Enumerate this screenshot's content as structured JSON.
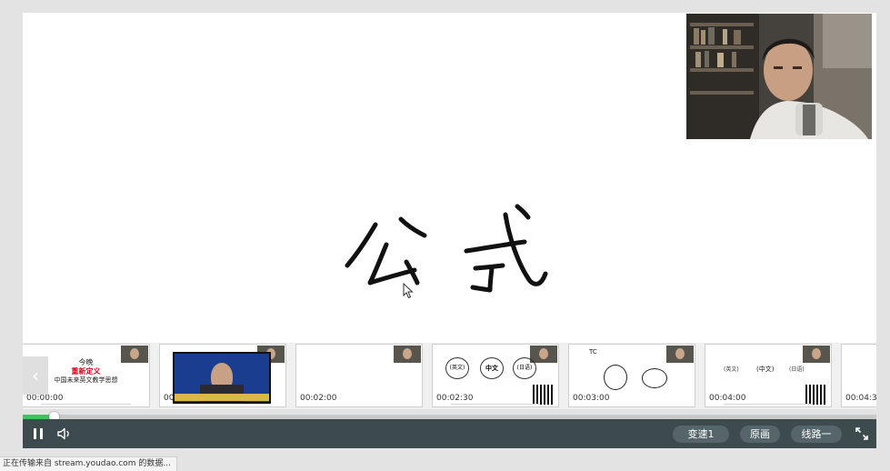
{
  "board": {
    "handwritten_text": "公式"
  },
  "thumbnails": [
    {
      "timestamp": "00:00:00",
      "lines": [
        "今晚",
        "重新定义",
        "中国未来英文教学思想"
      ],
      "accent_line": 1
    },
    {
      "timestamp": "00",
      "lines": []
    },
    {
      "timestamp": "00:02:00",
      "lines": []
    },
    {
      "timestamp": "00:02:30",
      "lines": [
        "(英文)",
        "中文",
        "(日语)"
      ]
    },
    {
      "timestamp": "00:03:00",
      "lines": [
        "TC"
      ]
    },
    {
      "timestamp": "00:04:00",
      "lines": [
        "(英文)",
        "(中文)",
        "(日语)"
      ]
    },
    {
      "timestamp": "00:04:30",
      "lines": []
    }
  ],
  "player": {
    "progress_fraction": 0.036,
    "speed_label": "变速1",
    "original_label": "原画",
    "line_label": "线路一"
  },
  "status_bar": {
    "text": "正在传输来自 stream.youdao.com 的数据..."
  },
  "colors": {
    "accent_green": "#3ec65e",
    "control_bar": "#3d4a4e",
    "accent_red": "#d0021b"
  }
}
